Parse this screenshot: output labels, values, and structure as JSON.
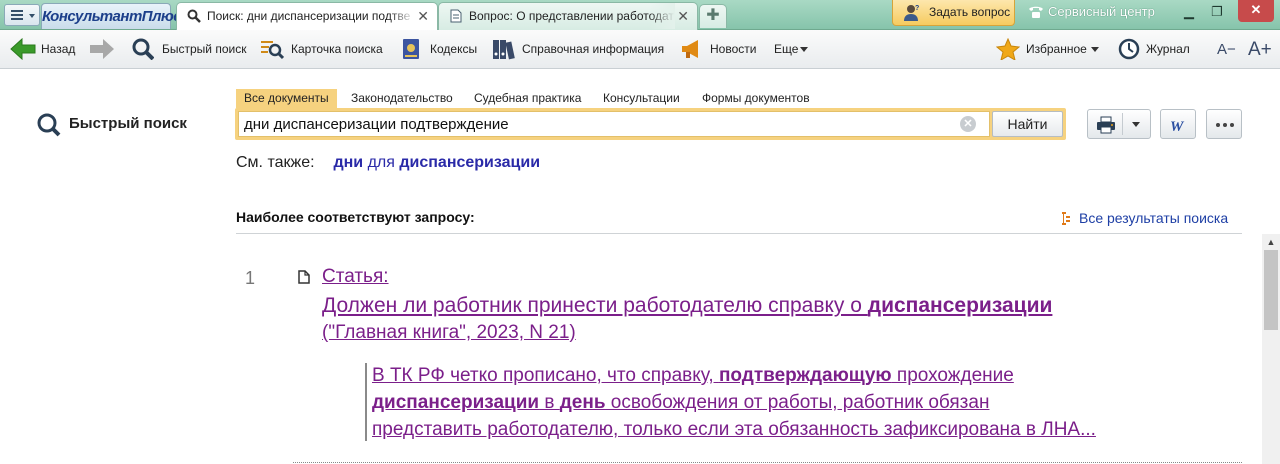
{
  "titlebar": {
    "logo": "КонсультантПлюс",
    "tabs": [
      {
        "label": "Поиск: дни диспансеризации подтве"
      },
      {
        "label": "Вопрос: О представлении работодат"
      }
    ],
    "ask_label": "Задать вопрос",
    "service_label": "Сервисный центр"
  },
  "toolbar": {
    "back": "Назад",
    "quick_search": "Быстрый поиск",
    "search_card": "Карточка поиска",
    "codes": "Кодексы",
    "reference": "Справочная информация",
    "news": "Новости",
    "more": "Еще",
    "favorites": "Избранное",
    "journal": "Журнал",
    "font_smaller": "A−",
    "font_larger": "A+"
  },
  "sidebar": {
    "title": "Быстрый поиск"
  },
  "search": {
    "tabs": [
      "Все документы",
      "Законодательство",
      "Судебная практика",
      "Консультации",
      "Формы документов"
    ],
    "query": "дни диспансеризации подтверждение",
    "find_label": "Найти"
  },
  "see_also": {
    "label": "См. также:",
    "w1": "дни",
    "w2": "для",
    "w3": "диспансеризации"
  },
  "results": {
    "heading": "Наиболее соответствуют запросу:",
    "all_link": "Все результаты поиска",
    "items": [
      {
        "num": "1",
        "type": "Статья:",
        "title_pre": "Должен ли работник принести работодателю справку о ",
        "title_bold": "диспансеризации",
        "source": "(\"Главная книга\", 2023, N 21)",
        "snippet": {
          "l1_a": "В ТК РФ четко прописано, что справку, ",
          "l1_b": "подтверждающую",
          "l1_c": " прохождение",
          "l2_a": "диспансеризации",
          "l2_b": " в ",
          "l2_c": "день",
          "l2_d": " освобождения от работы, работник обязан",
          "l3": "представить работодателю, только если эта обязанность зафиксирована в ЛНА..."
        }
      }
    ]
  },
  "colors": {
    "titlebar": "#86c4ab",
    "accent_tab": "#f6d27f",
    "link": "#1e3fa5",
    "visited": "#7b1f8a"
  }
}
